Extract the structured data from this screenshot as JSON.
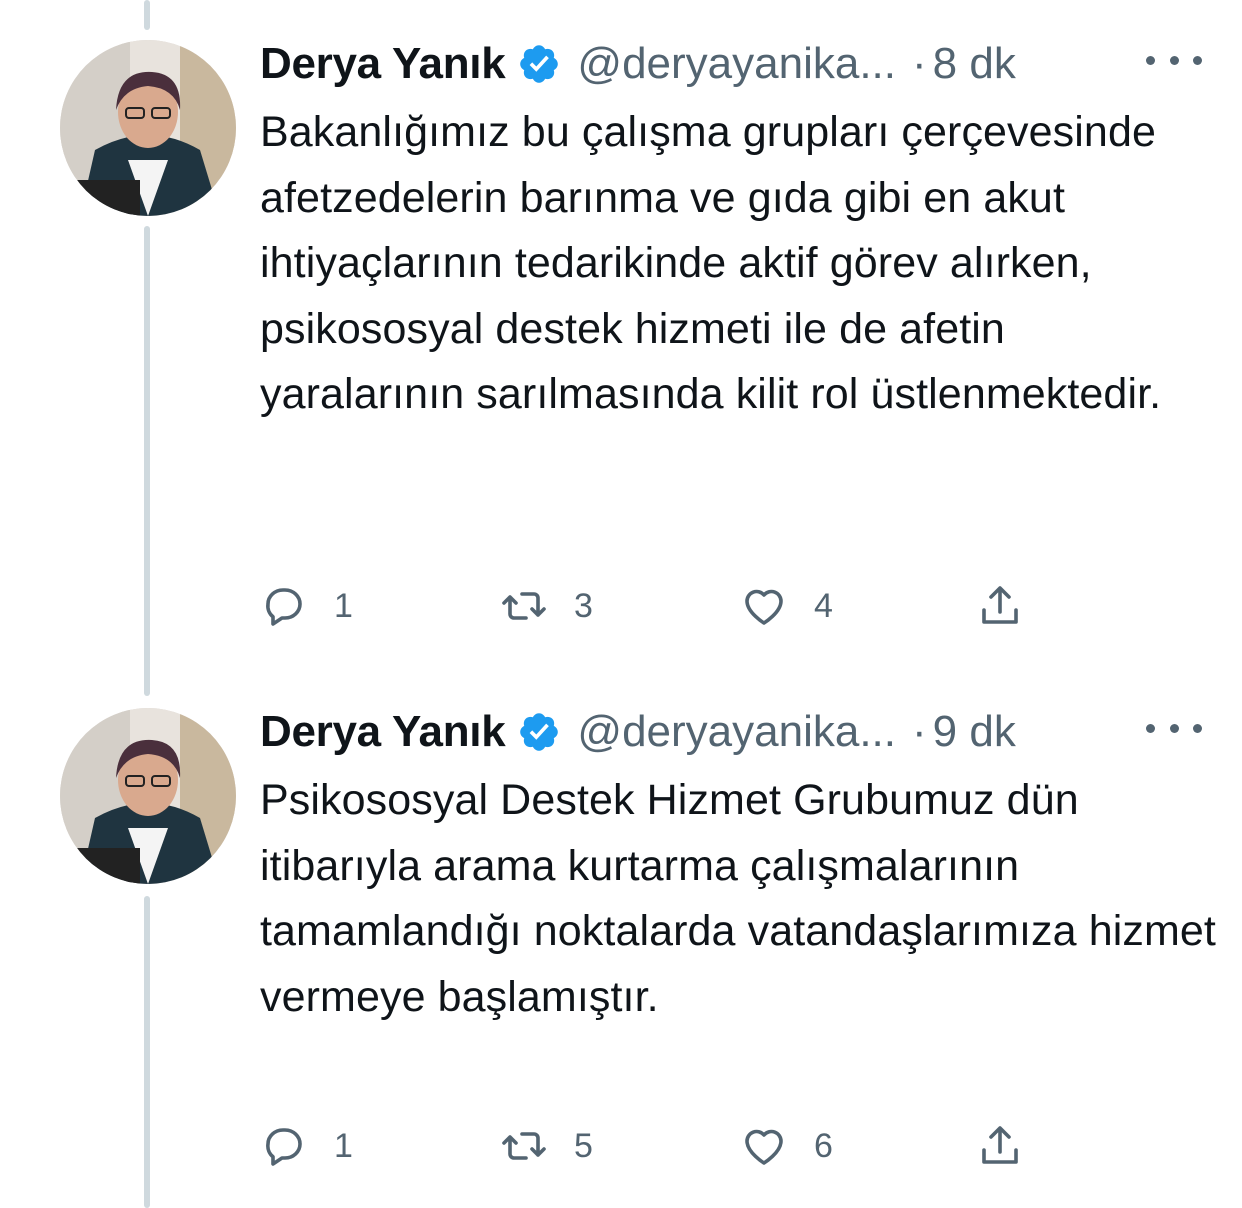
{
  "tweets": [
    {
      "author": "Derya Yanık",
      "handle": "@deryayanika...",
      "time_prefix": "·",
      "time": "8 dk",
      "text": "Bakanlığımız bu çalışma grupları çerçevesinde afetzedelerin barınma ve gıda gibi en akut ihtiyaçlarının tedarikinde aktif görev alırken, psikososyal destek hizmeti ile de afetin yaralarının sarılmasında kilit rol üstlenmektedir.",
      "replies": "1",
      "retweets": "3",
      "likes": "4"
    },
    {
      "author": "Derya Yanık",
      "handle": "@deryayanika...",
      "time_prefix": "·",
      "time": "9 dk",
      "text": "Psikososyal Destek Hizmet Grubumuz dün itibarıyla arama kurtarma çalışmalarının tamamlandığı noktalarda vatandaşlarımıza hizmet vermeye başlamıştır.",
      "replies": "1",
      "retweets": "5",
      "likes": "6"
    }
  ],
  "icons": {
    "reply": "reply-icon",
    "retweet": "retweet-icon",
    "like": "heart-icon",
    "share": "share-icon",
    "verified": "verified-badge-icon",
    "more": "more-icon"
  },
  "colors": {
    "verified": "#1d9bf0",
    "secondary_text": "#536471",
    "thread_line": "#cfd9de"
  }
}
